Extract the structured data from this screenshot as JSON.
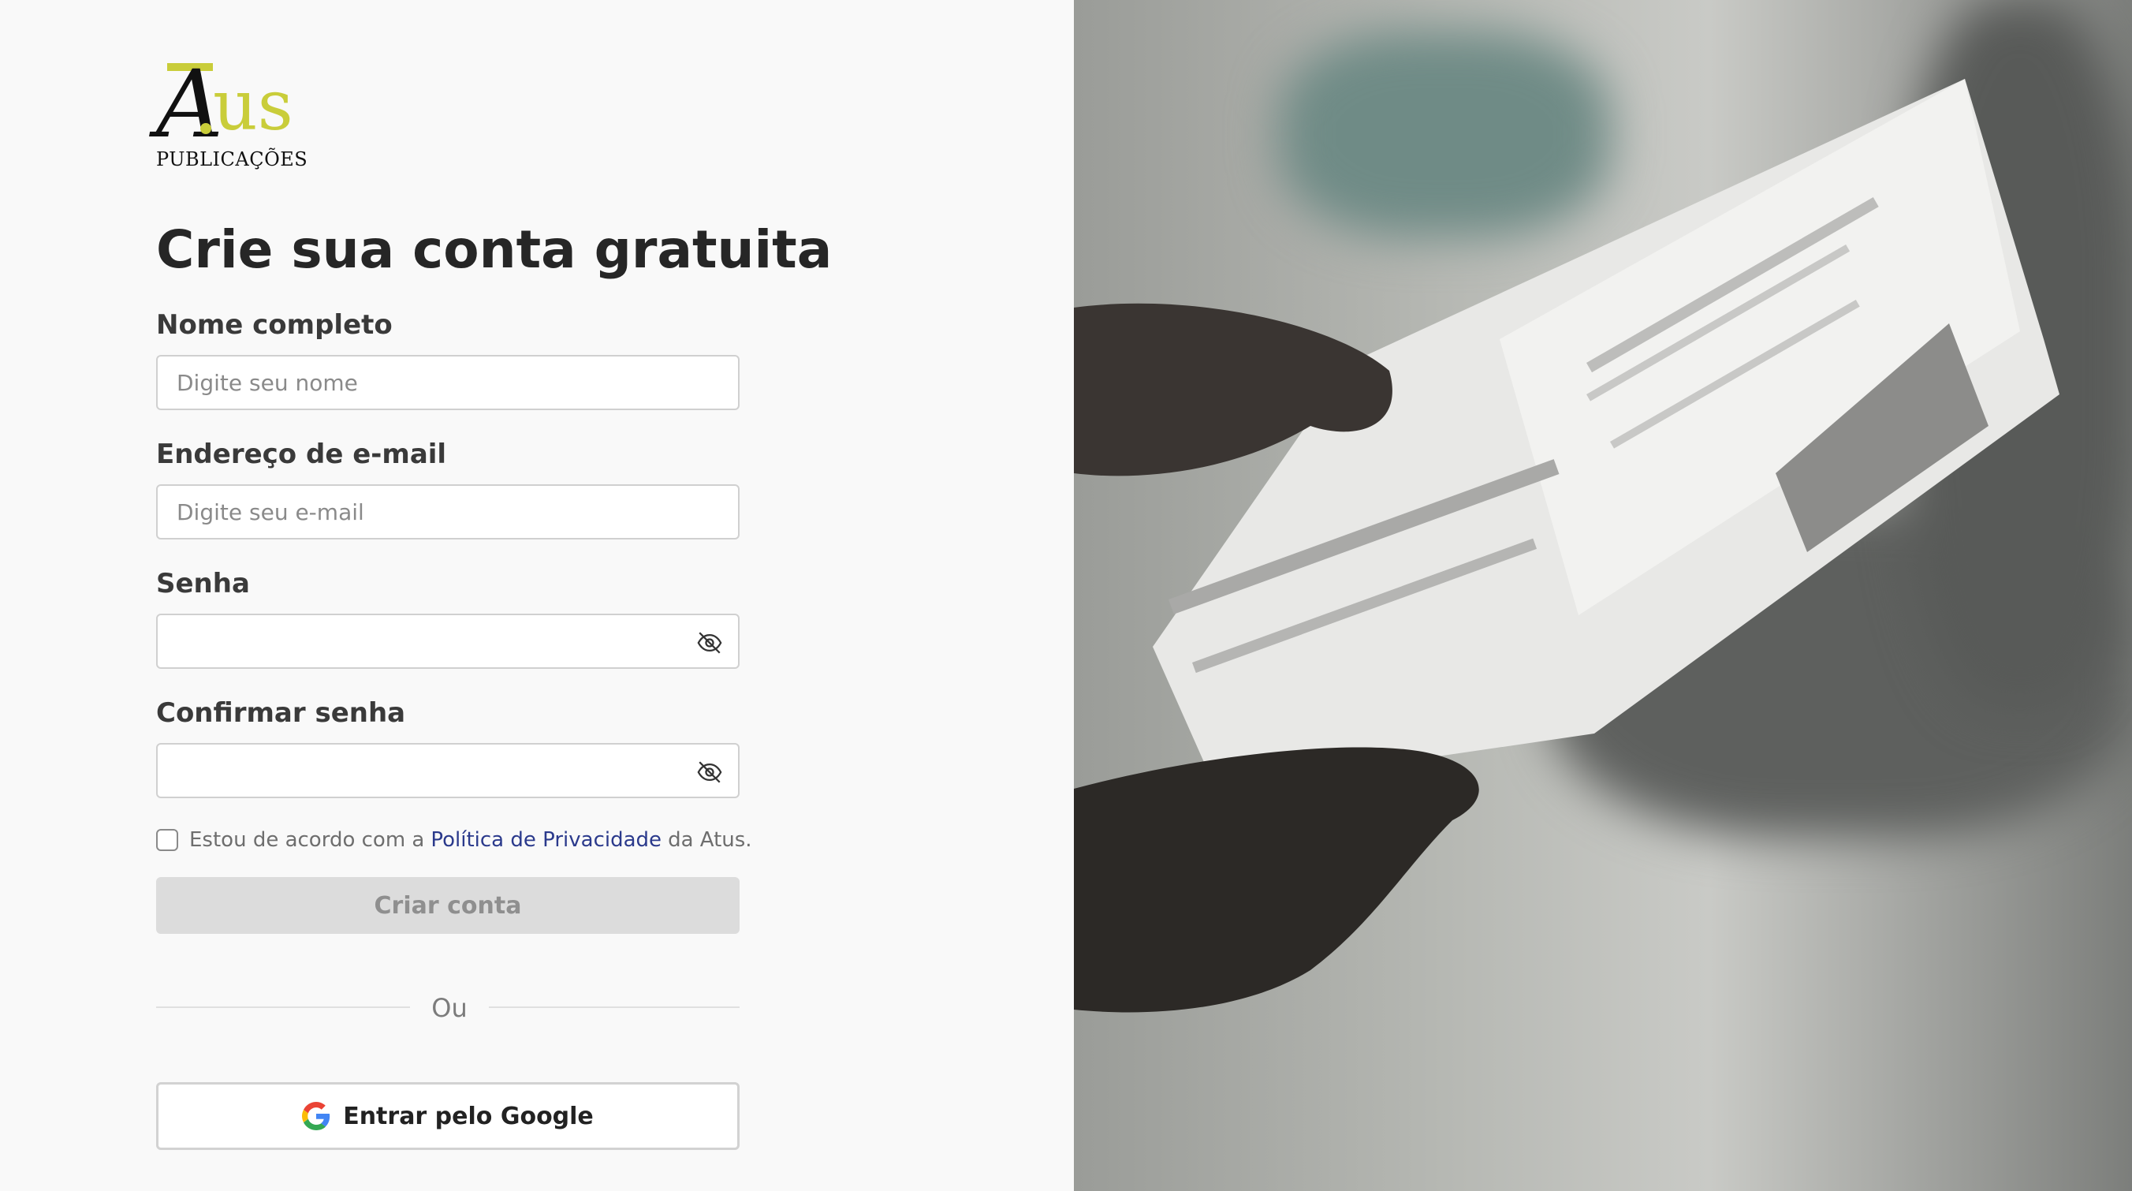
{
  "brand": {
    "logo_main": "A",
    "logo_us": "us",
    "logo_sub": "PUBLICAÇÕES"
  },
  "page": {
    "title": "Crie sua conta gratuita"
  },
  "form": {
    "name_label": "Nome completo",
    "name_placeholder": "Digite seu nome",
    "email_label": "Endereço de e-mail",
    "email_placeholder": "Digite seu e-mail",
    "password_label": "Senha",
    "confirm_label": "Confirmar senha",
    "agree_prefix": "Estou de acordo com a",
    "agree_link": "Política de Privacidade",
    "agree_suffix": "da Atus.",
    "submit_label": "Criar conta",
    "divider_text": "Ou",
    "google_label": "Entrar pelo Google"
  },
  "colors": {
    "brand_yellow": "#c9cd3a",
    "link": "#2b3a8c",
    "disabled_button": "#dcdcdc"
  },
  "icons": {
    "password_toggle": "eye-off-icon",
    "google": "google-g-icon"
  }
}
